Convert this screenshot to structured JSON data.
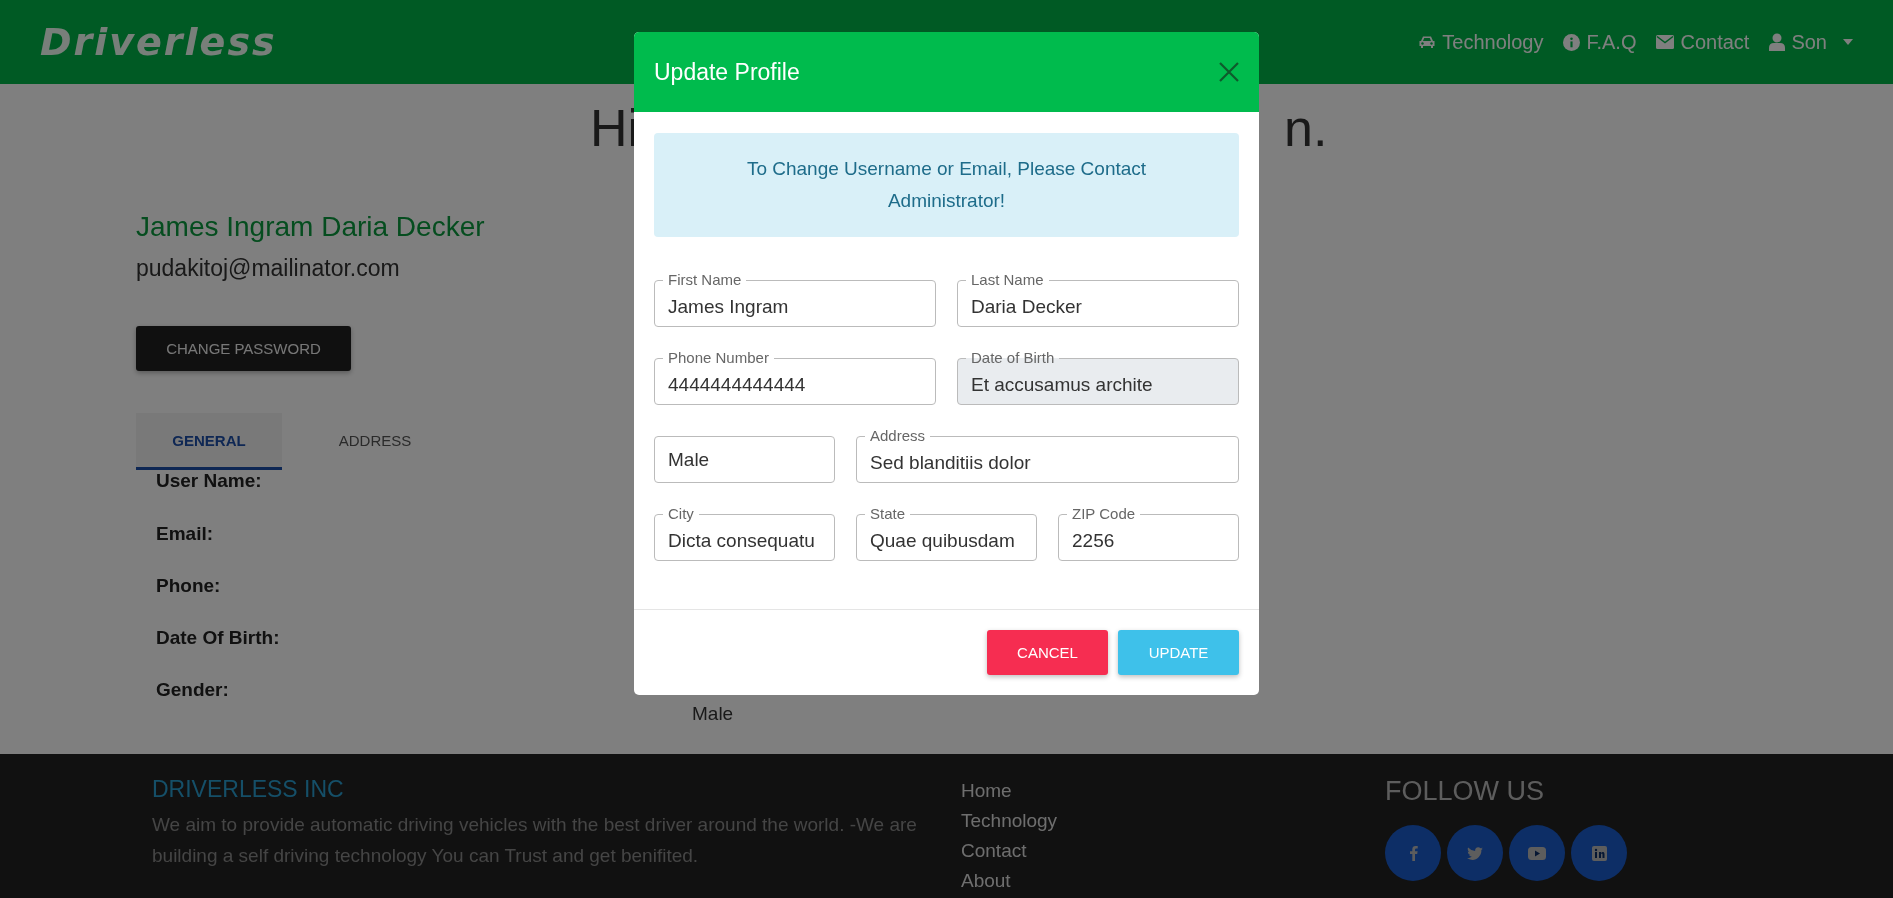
{
  "navbar": {
    "logo": "Driverless",
    "items": [
      {
        "kind": "car",
        "label": "Technology",
        "dropdown": false
      },
      {
        "kind": "info",
        "label": "F.A.Q",
        "dropdown": false
      },
      {
        "kind": "envelope",
        "label": "Contact",
        "dropdown": false
      },
      {
        "kind": "user",
        "label": "Son",
        "dropdown": true
      }
    ]
  },
  "heading": {
    "left_part": "Hi",
    "right_part": "n."
  },
  "profile": {
    "name": "James Ingram Daria Decker",
    "email": "pudakitoj@mailinator.com",
    "change_password": "CHANGE PASSWORD"
  },
  "tabs": [
    {
      "label": "GENERAL",
      "selected": true
    },
    {
      "label": "ADDRESS",
      "selected": false
    }
  ],
  "details": [
    {
      "label": "User Name:"
    },
    {
      "label": "Email:"
    },
    {
      "label": "Phone:"
    },
    {
      "label": "Date Of Birth:"
    },
    {
      "label": "Gender:",
      "value": "Male"
    }
  ],
  "modal": {
    "title": "Update Profile",
    "notice": "To Change Username or Email, Please Contact Administrator!",
    "rows": [
      {
        "fields": [
          {
            "kind": "text",
            "label": "First Name",
            "value": "James Ingram",
            "disabled": false
          },
          {
            "kind": "text",
            "label": "Last Name",
            "value": "Daria Decker",
            "disabled": false
          }
        ]
      },
      {
        "fields": [
          {
            "kind": "text",
            "label": "Phone Number",
            "value": "4444444444444",
            "disabled": false
          },
          {
            "kind": "text",
            "label": "Date of Birth",
            "value": "Et accusamus archite",
            "disabled": true
          }
        ]
      },
      {
        "fields": [
          {
            "kind": "select",
            "value": "Male",
            "disabled": false
          },
          {
            "kind": "text",
            "label": "Address",
            "value": "Sed blanditiis dolor",
            "disabled": false
          }
        ]
      },
      {
        "fields": [
          {
            "kind": "text",
            "label": "City",
            "value": "Dicta consequatu",
            "disabled": false
          },
          {
            "kind": "text",
            "label": "State",
            "value": "Quae quibusdam",
            "disabled": false
          },
          {
            "kind": "text",
            "label": "ZIP Code",
            "value": "2256",
            "disabled": false
          }
        ]
      }
    ],
    "buttons": [
      {
        "kind": "cancel",
        "label": "CANCEL"
      },
      {
        "kind": "update",
        "label": "UPDATE"
      }
    ]
  },
  "footer": {
    "company": "DRIVERLESS INC",
    "about": "We aim to provide automatic driving vehicles with the best driver around the world. -We are building a self driving technology You can Trust and get benifited.",
    "links": [
      "Home",
      "Technology",
      "Contact",
      "About"
    ],
    "follow_title": "FOLLOW US",
    "social": [
      {
        "kind": "facebook"
      },
      {
        "kind": "twitter"
      },
      {
        "kind": "youtube"
      },
      {
        "kind": "linkedin"
      }
    ]
  }
}
